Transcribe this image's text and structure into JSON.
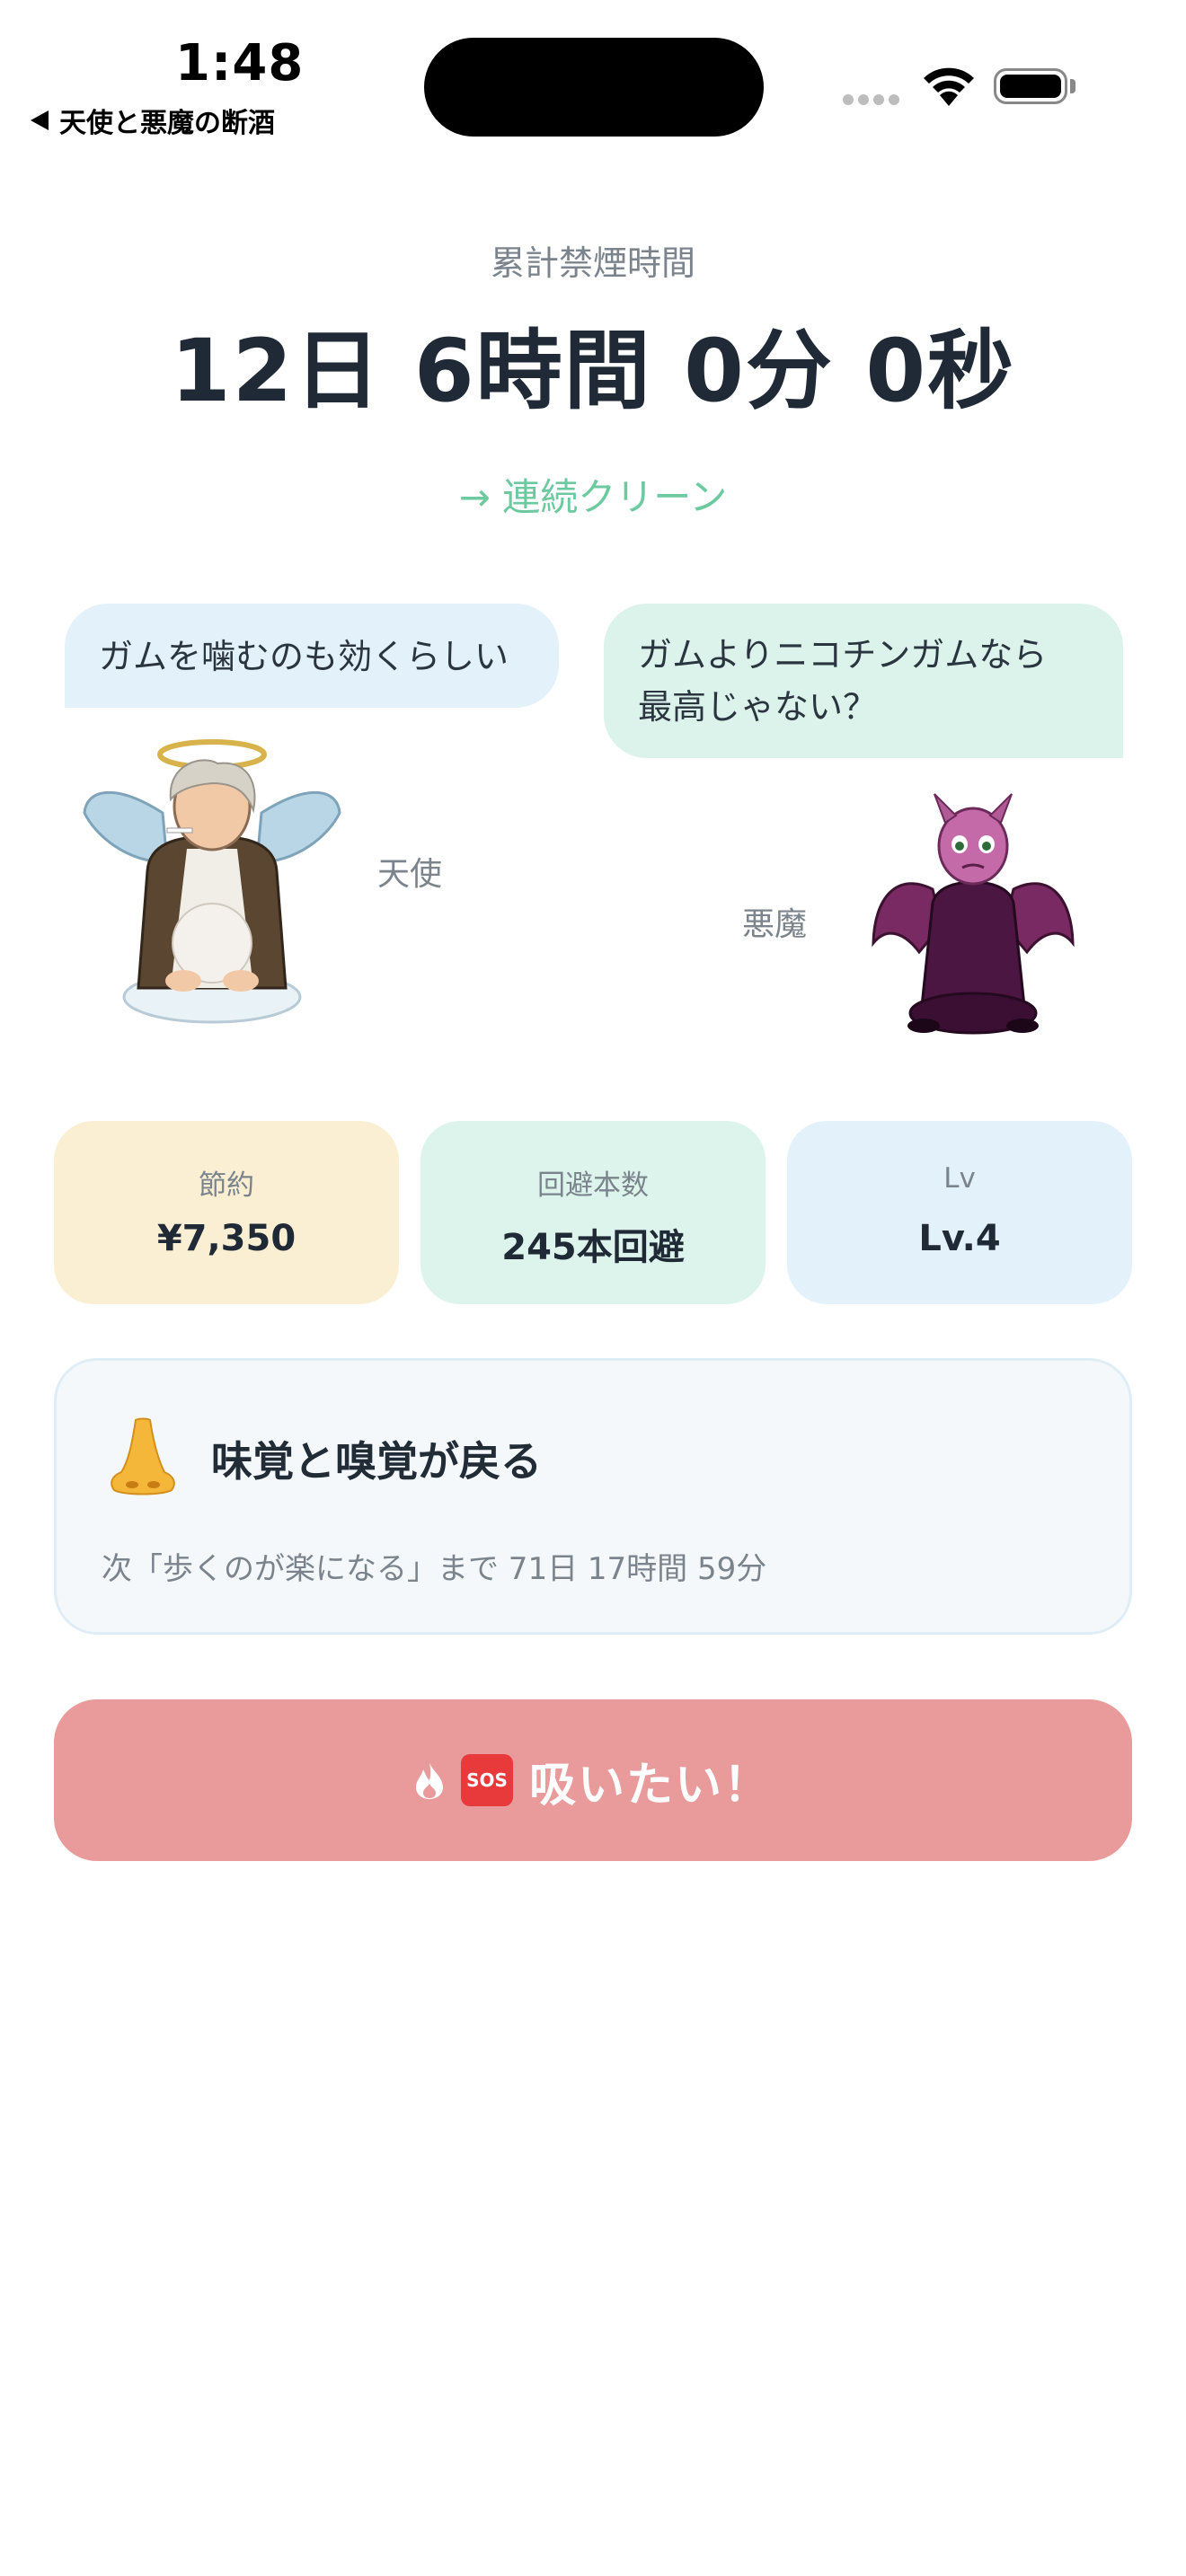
{
  "status_bar": {
    "time": "1:48",
    "back_label": "天使と悪魔の断酒"
  },
  "timer": {
    "label": "累計禁煙時間",
    "value": "12日 6時間 0分 0秒",
    "streak_link": "→ 連続クリーン"
  },
  "characters": {
    "angel": {
      "name": "天使",
      "speech": "ガムを噛むのも効くらしい"
    },
    "devil": {
      "name": "悪魔",
      "speech_line1": "ガムよりニコチンガムなら",
      "speech_line2": "最高じゃない？"
    }
  },
  "stats": [
    {
      "label": "節約",
      "value": "¥7,350",
      "color": "#fbefd3"
    },
    {
      "label": "回避本数",
      "value": "245本回避",
      "color": "#dcf4eb"
    },
    {
      "label": "Lv",
      "value": "Lv.4",
      "color": "#e3f1fb"
    }
  ],
  "milestone": {
    "icon": "nose-icon",
    "title": "味覚と嗅覚が戻る",
    "next": "次「歩くのが楽になる」まで 71日 17時間 59分"
  },
  "sos": {
    "label": "吸いたい！",
    "badge": "SOS",
    "color": "#e99a9a"
  }
}
